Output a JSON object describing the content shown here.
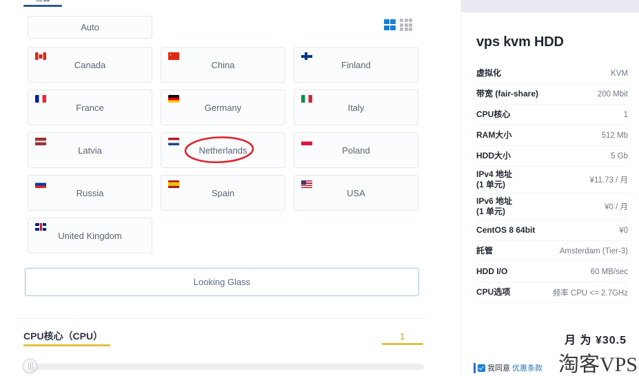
{
  "tab": {
    "label": "位置"
  },
  "view_toggles": {
    "grid_two_col": "grid-2-icon",
    "grid_three_col": "grid-3-icon",
    "active": "grid_two_col",
    "active_color": "#1a7fd4",
    "inactive_color": "#b9bcc2"
  },
  "location": {
    "auto_label": "Auto",
    "countries": [
      {
        "name": "Canada",
        "flag": "flag-ca"
      },
      {
        "name": "China",
        "flag": "flag-cn"
      },
      {
        "name": "Finland",
        "flag": "flag-fi"
      },
      {
        "name": "France",
        "flag": "flag-fr"
      },
      {
        "name": "Germany",
        "flag": "flag-de"
      },
      {
        "name": "Italy",
        "flag": "flag-it"
      },
      {
        "name": "Latvia",
        "flag": "flag-lv"
      },
      {
        "name": "Netherlands",
        "flag": "flag-nl"
      },
      {
        "name": "Poland",
        "flag": "flag-pl"
      },
      {
        "name": "Russia",
        "flag": "flag-ru"
      },
      {
        "name": "Spain",
        "flag": "flag-es"
      },
      {
        "name": "USA",
        "flag": "flag-us"
      },
      {
        "name": "United Kingdom",
        "flag": "flag-gb"
      }
    ],
    "annotation": {
      "shape": "ellipse",
      "target": "Netherlands",
      "color": "#e0232c"
    },
    "looking_glass_label": "Looking Glass"
  },
  "cpu": {
    "label": "CPU核心（CPU）",
    "value": "1",
    "accent_color": "#e0c341",
    "slider_position_percent": 0
  },
  "plan": {
    "title": "vps kvm HDD",
    "specs": [
      {
        "label": "虚拟化",
        "value": "KVM"
      },
      {
        "label": "带宽 (fair-share)",
        "value": "200 Mbit"
      },
      {
        "label": "CPU核心",
        "value": "1"
      },
      {
        "label": "RAM大小",
        "value": "512 Mb"
      },
      {
        "label": "HDD大小",
        "value": "5 Gb"
      },
      {
        "label": "IPv4 地址\n(1 单元)",
        "value": "¥11.73 / 月"
      },
      {
        "label": "IPv6 地址\n(1 单元)",
        "value": "¥0 / 月"
      },
      {
        "label": "CentOS 8 64bit",
        "value": "¥0"
      },
      {
        "label": "託管",
        "value": "Amsterdam (Tier-3)"
      },
      {
        "label": "HDD I/O",
        "value": "60 MB/sec"
      },
      {
        "label": "CPU选项",
        "value": "频率 CPU <= 2.7GHz"
      }
    ],
    "price_line": "月 为 ¥30.5",
    "agree_text": "我同意",
    "agree_link": "优惠条款",
    "agree_checked": true
  },
  "watermark": {
    "text": "淘客VPS"
  }
}
